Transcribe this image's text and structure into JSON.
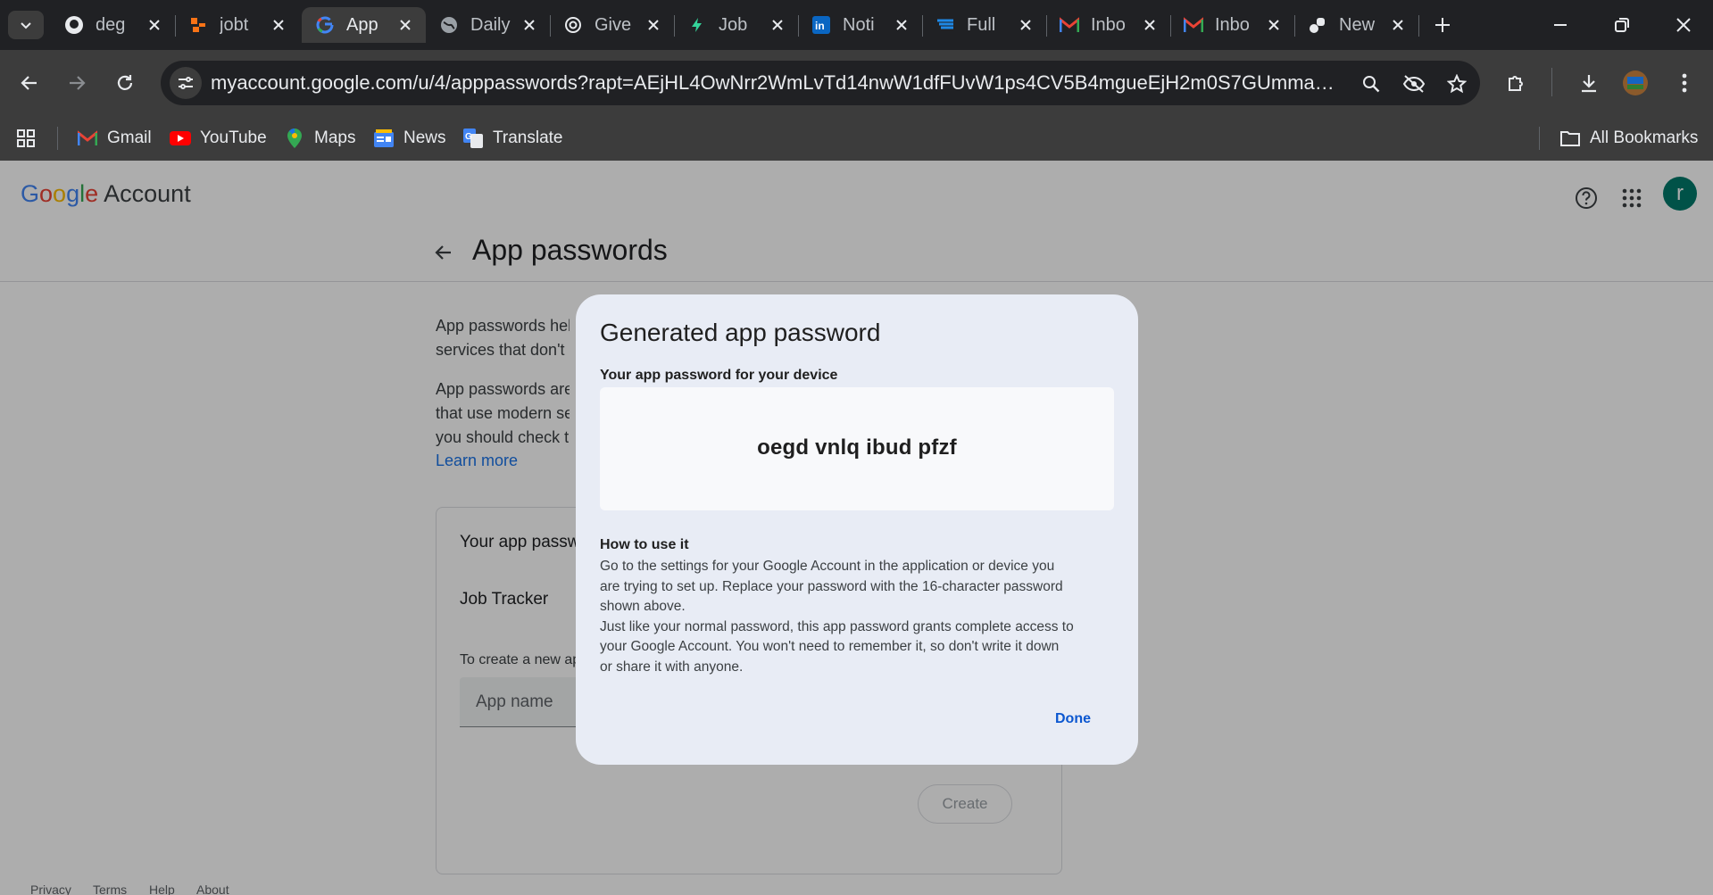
{
  "browser": {
    "tabs": [
      {
        "title": "deg",
        "icon": "github-icon"
      },
      {
        "title": "jobt",
        "icon": "jobtracker-icon"
      },
      {
        "title": "App",
        "icon": "google-icon",
        "active": true
      },
      {
        "title": "Daily",
        "icon": "globe-icon"
      },
      {
        "title": "Give",
        "icon": "openai-icon"
      },
      {
        "title": "Job",
        "icon": "bolt-icon"
      },
      {
        "title": "Noti",
        "icon": "linkedin-icon"
      },
      {
        "title": "Full",
        "icon": "flag-icon"
      },
      {
        "title": "Inbo",
        "icon": "gmail-icon"
      },
      {
        "title": "Inbo",
        "icon": "gmail-icon"
      },
      {
        "title": "New",
        "icon": "notion-icon"
      }
    ],
    "url": "myaccount.google.com/u/4/apppasswords?rapt=AEjHL4OwNrr2WmLvTd14nwW1dfFUvW1ps4CV5B4mgueEjH2m0S7GUmmaQEVizAfC...",
    "bookmarks": [
      "Gmail",
      "YouTube",
      "Maps",
      "News",
      "Translate"
    ],
    "all_bookmarks": "All Bookmarks"
  },
  "header": {
    "logo_word": "Google",
    "logo_suffix": "Account",
    "avatar_letter": "r"
  },
  "page": {
    "title": "App passwords",
    "desc1": [
      "App passwords hel",
      "services that don't"
    ],
    "desc2": [
      "App passwords are",
      "that use modern se",
      "you should check t"
    ],
    "learn_more": "Learn more",
    "card_title": "Your app passwords",
    "app_item": "Job Tracker",
    "create_hint": "To create a new app",
    "app_name_placeholder": "App name",
    "create_button": "Create",
    "footer": [
      "Privacy",
      "Terms",
      "Help",
      "About"
    ]
  },
  "dialog": {
    "title": "Generated app password",
    "subtitle": "Your app password for your device",
    "password": "oegd vnlq ibud pfzf",
    "how_title": "How to use it",
    "how_lines": [
      "Go to the settings for your Google Account in the application or device you",
      "are trying to set up. Replace your password with the 16-character password",
      "shown above.",
      "Just like your normal password, this app password grants complete access to",
      "your Google Account. You won't need to remember it, so don't write it down",
      "or share it with anyone."
    ],
    "done": "Done"
  },
  "colors": {
    "accent": "#0b57d0",
    "avatar": "#00796b",
    "dialog_bg": "#e8ecf5"
  }
}
